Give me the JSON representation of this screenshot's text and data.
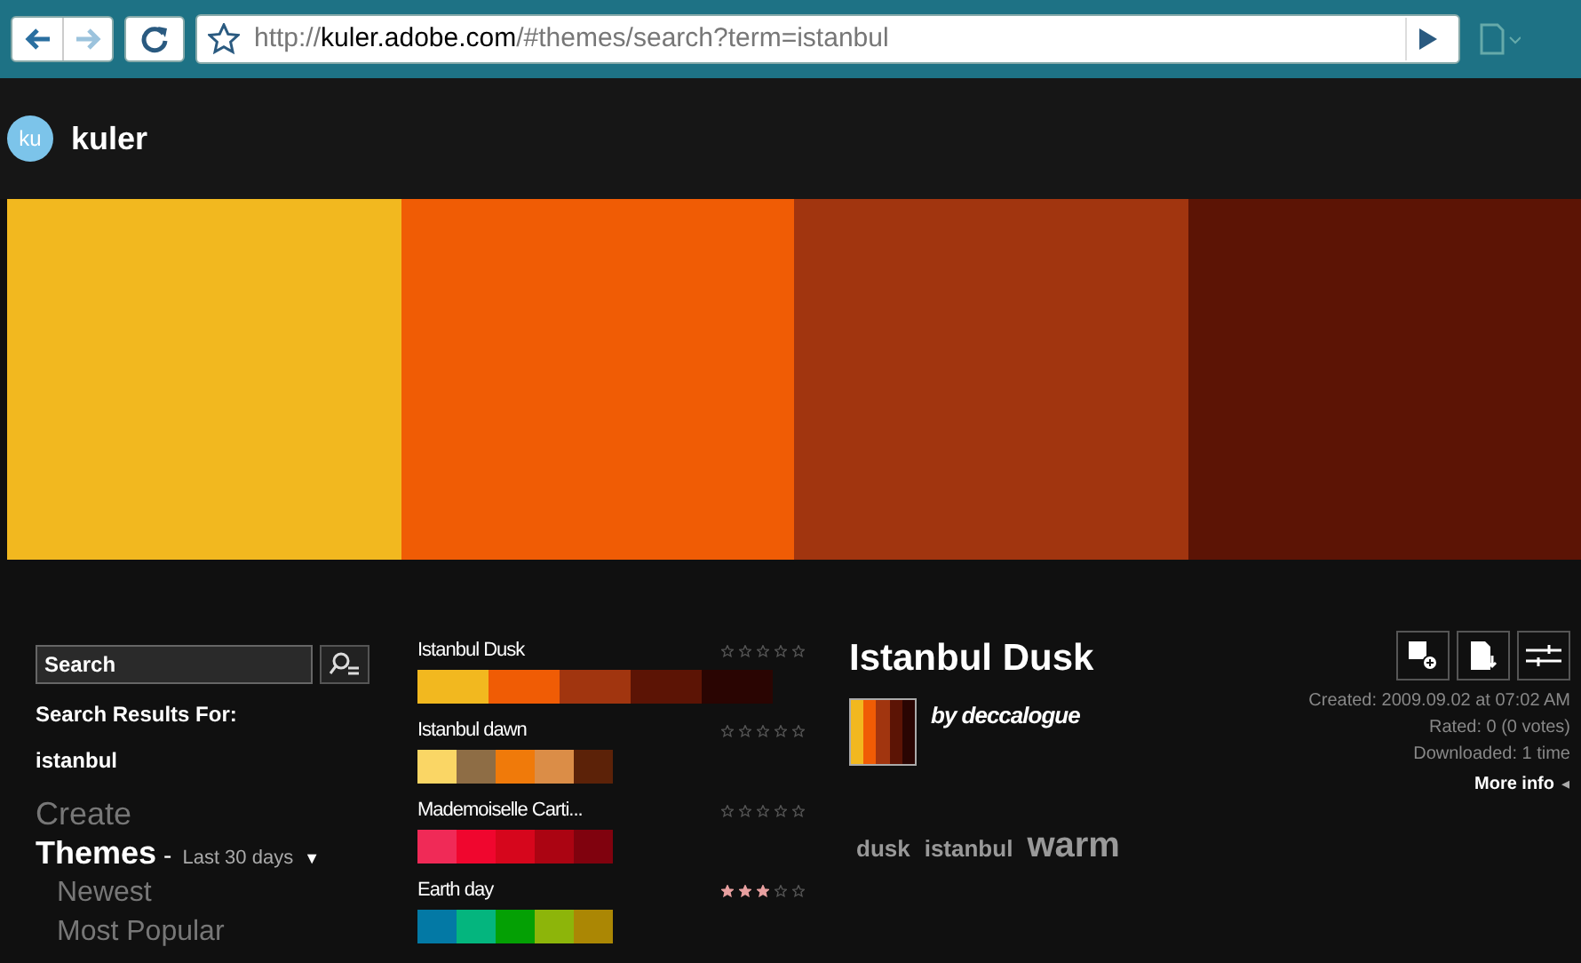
{
  "browser": {
    "address_prefix": "http://",
    "address_host": "kuler.adobe.com",
    "address_path": "/#themes/search?term=istanbul"
  },
  "header": {
    "logo_badge": "ku",
    "logo_text": "kuler"
  },
  "hero": {
    "swatches": [
      {
        "color": "#f2b81f"
      },
      {
        "color": "#f05c05"
      },
      {
        "color": "#a1350f"
      },
      {
        "color": "#5c1405"
      }
    ]
  },
  "sidebar": {
    "search": {
      "placeholder": "Search"
    },
    "results_label": "Search Results For:",
    "results_term": "istanbul",
    "nav": [
      {
        "label": "Create",
        "kind": "top",
        "selected": false
      },
      {
        "label": "Themes",
        "kind": "top",
        "selected": true,
        "separator": "-",
        "filter": "Last 30 days",
        "dropdown_caret": "▼"
      },
      {
        "label": "Newest",
        "kind": "sub",
        "selected": false
      },
      {
        "label": "Most Popular",
        "kind": "sub",
        "selected": false
      }
    ]
  },
  "themes": [
    {
      "name": "Istanbul Dusk",
      "stars": 0,
      "swatches": [
        {
          "color": "#f2b81f"
        },
        {
          "color": "#f05c05"
        },
        {
          "color": "#a1350f"
        },
        {
          "color": "#5c1405"
        },
        {
          "color": "#2a0502"
        }
      ]
    },
    {
      "name": "Istanbul dawn",
      "stars": 0,
      "swatches": [
        {
          "color": "#fad665"
        },
        {
          "color": "#8e6d45"
        },
        {
          "color": "#f07a0a"
        },
        {
          "color": "#db8d47"
        },
        {
          "color": "#5c2208"
        }
      ]
    },
    {
      "name": "Mademoiselle Carti...",
      "stars": 0,
      "swatches": [
        {
          "color": "#f02a57"
        },
        {
          "color": "#f0062e"
        },
        {
          "color": "#d6061c"
        },
        {
          "color": "#ab0412"
        },
        {
          "color": "#80020e"
        }
      ]
    },
    {
      "name": "Earth day",
      "stars": 3,
      "swatches": [
        {
          "color": "#0379a5"
        },
        {
          "color": "#04b57e"
        },
        {
          "color": "#04a004"
        },
        {
          "color": "#8db50a"
        },
        {
          "color": "#ab8704"
        }
      ]
    }
  ],
  "detail": {
    "title": "Istanbul Dusk",
    "author": "by deccalogue",
    "thumb": [
      {
        "color": "#f2b81f"
      },
      {
        "color": "#f05c05"
      },
      {
        "color": "#a1350f"
      },
      {
        "color": "#5c1405"
      },
      {
        "color": "#2a0502"
      }
    ],
    "tags": [
      {
        "label": "dusk",
        "kind": "plain"
      },
      {
        "label": "istanbul",
        "kind": "plain"
      },
      {
        "label": "warm",
        "kind": "emphasized"
      }
    ],
    "created": "Created: 2009.09.02 at 07:02 AM",
    "rated": "Rated: 0 (0 votes)",
    "downloaded": "Downloaded: 1 time",
    "more_info": "More info",
    "more_info_arrow": "◂"
  }
}
